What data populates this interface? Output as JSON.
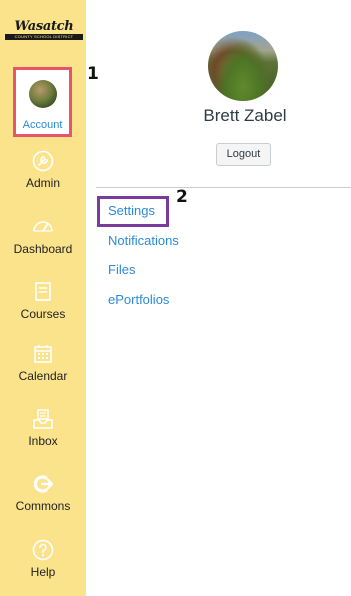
{
  "logo": {
    "name": "Wasatch",
    "tagline": "COUNTY SCHOOL DISTRICT"
  },
  "sidebar": {
    "account_label": "Account",
    "items": [
      {
        "label": "Admin",
        "icon": "admin-icon"
      },
      {
        "label": "Dashboard",
        "icon": "dashboard-icon"
      },
      {
        "label": "Courses",
        "icon": "courses-icon"
      },
      {
        "label": "Calendar",
        "icon": "calendar-icon"
      },
      {
        "label": "Inbox",
        "icon": "inbox-icon"
      },
      {
        "label": "Commons",
        "icon": "commons-icon"
      },
      {
        "label": "Help",
        "icon": "help-icon"
      }
    ],
    "icon_color": "#ffffff",
    "background": "#fbe38c"
  },
  "annotations": {
    "step1": "1",
    "step2": "2"
  },
  "profile": {
    "name": "Brett Zabel",
    "logout_label": "Logout",
    "links": [
      "Settings",
      "Notifications",
      "Files",
      "ePortfolios"
    ]
  },
  "colors": {
    "link": "#2b8bd8",
    "account_highlight": "#e8556b",
    "settings_highlight": "#7a3b9c"
  }
}
